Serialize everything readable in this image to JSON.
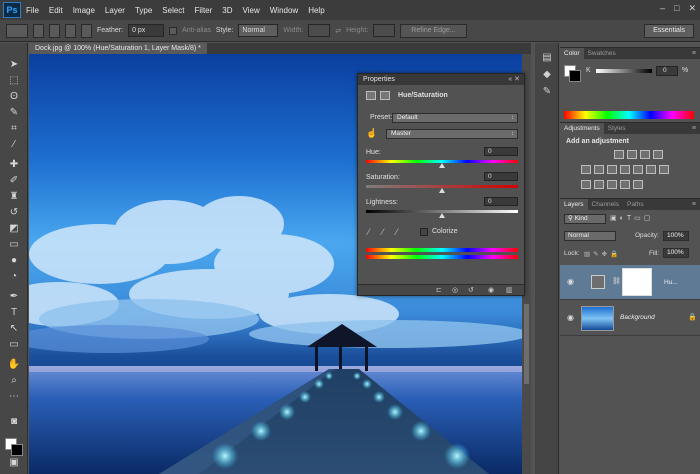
{
  "app": {
    "logo": "Ps"
  },
  "menu": [
    "File",
    "Edit",
    "Image",
    "Layer",
    "Type",
    "Select",
    "Filter",
    "3D",
    "View",
    "Window",
    "Help"
  ],
  "window_controls": [
    "–",
    "□",
    "✕"
  ],
  "options": {
    "feather_label": "Feather:",
    "feather_value": "0 px",
    "antialias_label": "Anti-alias",
    "style_label": "Style:",
    "style_value": "Normal",
    "width_label": "Width:",
    "height_label": "Height:",
    "refine_label": "Refine Edge...",
    "workspace": "Essentials"
  },
  "document": {
    "tab_title": "Dock.jpg @ 100% (Hue/Saturation 1, Layer Mask/8) *"
  },
  "properties": {
    "tab": "Properties",
    "adjustment_title": "Hue/Saturation",
    "preset_label": "Preset:",
    "preset_value": "Default",
    "channel_value": "Master",
    "hue_label": "Hue:",
    "hue_value": "0",
    "saturation_label": "Saturation:",
    "saturation_value": "0",
    "lightness_label": "Lightness:",
    "lightness_value": "0",
    "colorize_label": "Colorize"
  },
  "color_panel": {
    "tabs": [
      "Color",
      "Swatches"
    ],
    "k_label": "K",
    "k_value": "0",
    "k_unit": "%"
  },
  "adjustments_panel": {
    "tabs": [
      "Adjustments",
      "Styles"
    ],
    "title": "Add an adjustment"
  },
  "layers_panel": {
    "tabs": [
      "Layers",
      "Channels",
      "Paths"
    ],
    "filter_value": "Kind",
    "blend_mode": "Normal",
    "opacity_label": "Opacity:",
    "opacity_value": "100%",
    "lock_label": "Lock:",
    "fill_label": "Fill:",
    "fill_value": "100%",
    "layers": [
      {
        "name": "Hu..."
      },
      {
        "name": "Background"
      }
    ]
  },
  "colors": {
    "accent": "#31a8ff",
    "selected_layer": "#5f7a95"
  }
}
